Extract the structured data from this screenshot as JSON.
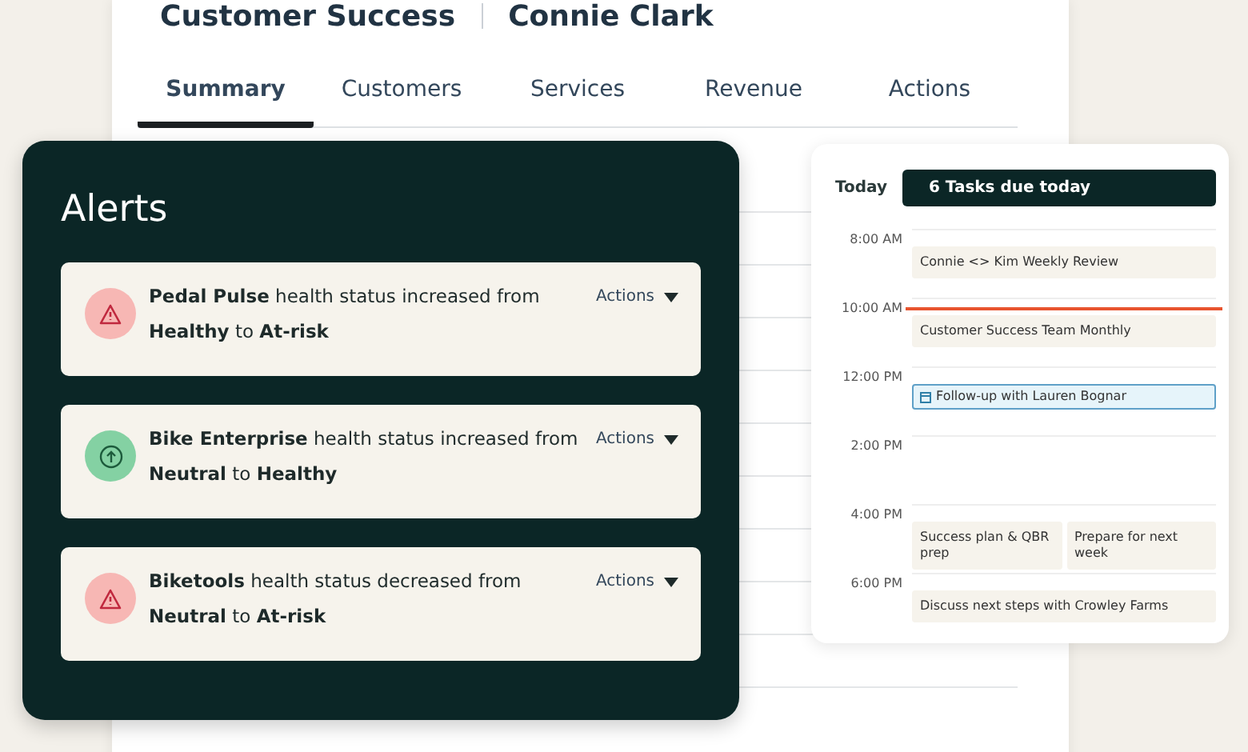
{
  "header": {
    "team": "Customer Success",
    "person": "Connie Clark"
  },
  "tabs": [
    {
      "label": "Summary",
      "selected": true
    },
    {
      "label": "Customers",
      "selected": false
    },
    {
      "label": "Services",
      "selected": false
    },
    {
      "label": "Revenue",
      "selected": false
    },
    {
      "label": "Actions",
      "selected": false
    }
  ],
  "alerts": {
    "title": "Alerts",
    "items": [
      {
        "kind": "risk",
        "text": "**Pedal Pulse** health status increased from **Healthy** to **At-risk**",
        "action": "Actions"
      },
      {
        "kind": "healthy",
        "text": "**Bike Enterprise** health status increased from **Neutral** to **Healthy**",
        "action": "Actions"
      },
      {
        "kind": "risk",
        "text": "**Biketools** health status decreased from **Neutral** to **At-risk**",
        "action": "Actions"
      }
    ]
  },
  "calendar": {
    "day": "Today",
    "banner": "6 Tasks due today",
    "slots": [
      {
        "time": "8:00 AM",
        "now": false,
        "events": [
          {
            "kind": "meeting",
            "title": "Connie <> Kim Weekly Review"
          }
        ]
      },
      {
        "time": "10:00 AM",
        "now": true,
        "events": [
          {
            "kind": "meeting",
            "title": "Customer Success Team Monthly"
          }
        ]
      },
      {
        "time": "12:00 PM",
        "now": false,
        "events": [
          {
            "kind": "task",
            "title": "Follow-up with Lauren Bognar"
          }
        ]
      },
      {
        "time": "2:00 PM",
        "now": false
      },
      {
        "time": "4:00 PM",
        "now": false,
        "events": [
          {
            "kind": "meeting",
            "title": "Success plan & QBR prep"
          },
          {
            "kind": "meeting",
            "title": "Prepare for next week"
          }
        ]
      },
      {
        "time": "6:00 PM",
        "now": false,
        "events": [
          {
            "kind": "meeting",
            "title": "Discuss next steps with Crowley Farms"
          }
        ]
      }
    ]
  }
}
